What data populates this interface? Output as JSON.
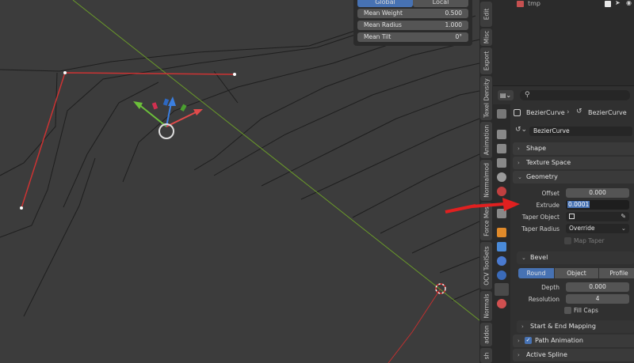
{
  "npanel": {
    "seg_global": "Global",
    "seg_local": "Local",
    "rows": [
      {
        "label": "Mean Weight",
        "value": "0.500"
      },
      {
        "label": "Mean Radius",
        "value": "1.000"
      },
      {
        "label": "Mean Tilt",
        "value": "0°"
      }
    ]
  },
  "tabs": [
    "Edit",
    "Misc",
    "Export",
    "Texel Density",
    "Animation",
    "Normalmod",
    "Force Mes",
    "OCV ToolSets",
    "Normals",
    "addon",
    "sh"
  ],
  "outliner": {
    "item": "tmp"
  },
  "props": {
    "breadcrumb_obj": "BezierCurve",
    "breadcrumb_data": "BezierCurve",
    "data_name": "BezierCurve",
    "sections": {
      "shape": "Shape",
      "texture_space": "Texture Space",
      "geometry": "Geometry"
    },
    "geometry": {
      "offset_label": "Offset",
      "offset_value": "0.000",
      "extrude_label": "Extrude",
      "extrude_value": "0.0001",
      "taper_object_label": "Taper Object",
      "taper_radius_label": "Taper Radius",
      "taper_radius_value": "Override",
      "map_taper": "Map Taper"
    },
    "bevel": {
      "title": "Bevel",
      "modes": [
        "Round",
        "Object",
        "Profile"
      ],
      "depth_label": "Depth",
      "depth_value": "0.000",
      "resolution_label": "Resolution",
      "resolution_value": "4",
      "fill_caps": "Fill Caps"
    },
    "start_end": "Start & End Mapping",
    "path_animation": "Path Animation",
    "active_spline": "Active Spline"
  },
  "colors": {
    "accent": "#4772b3",
    "arrow": "#e02020",
    "curve": "#cc3333",
    "axis_y": "#6a9a2a"
  }
}
